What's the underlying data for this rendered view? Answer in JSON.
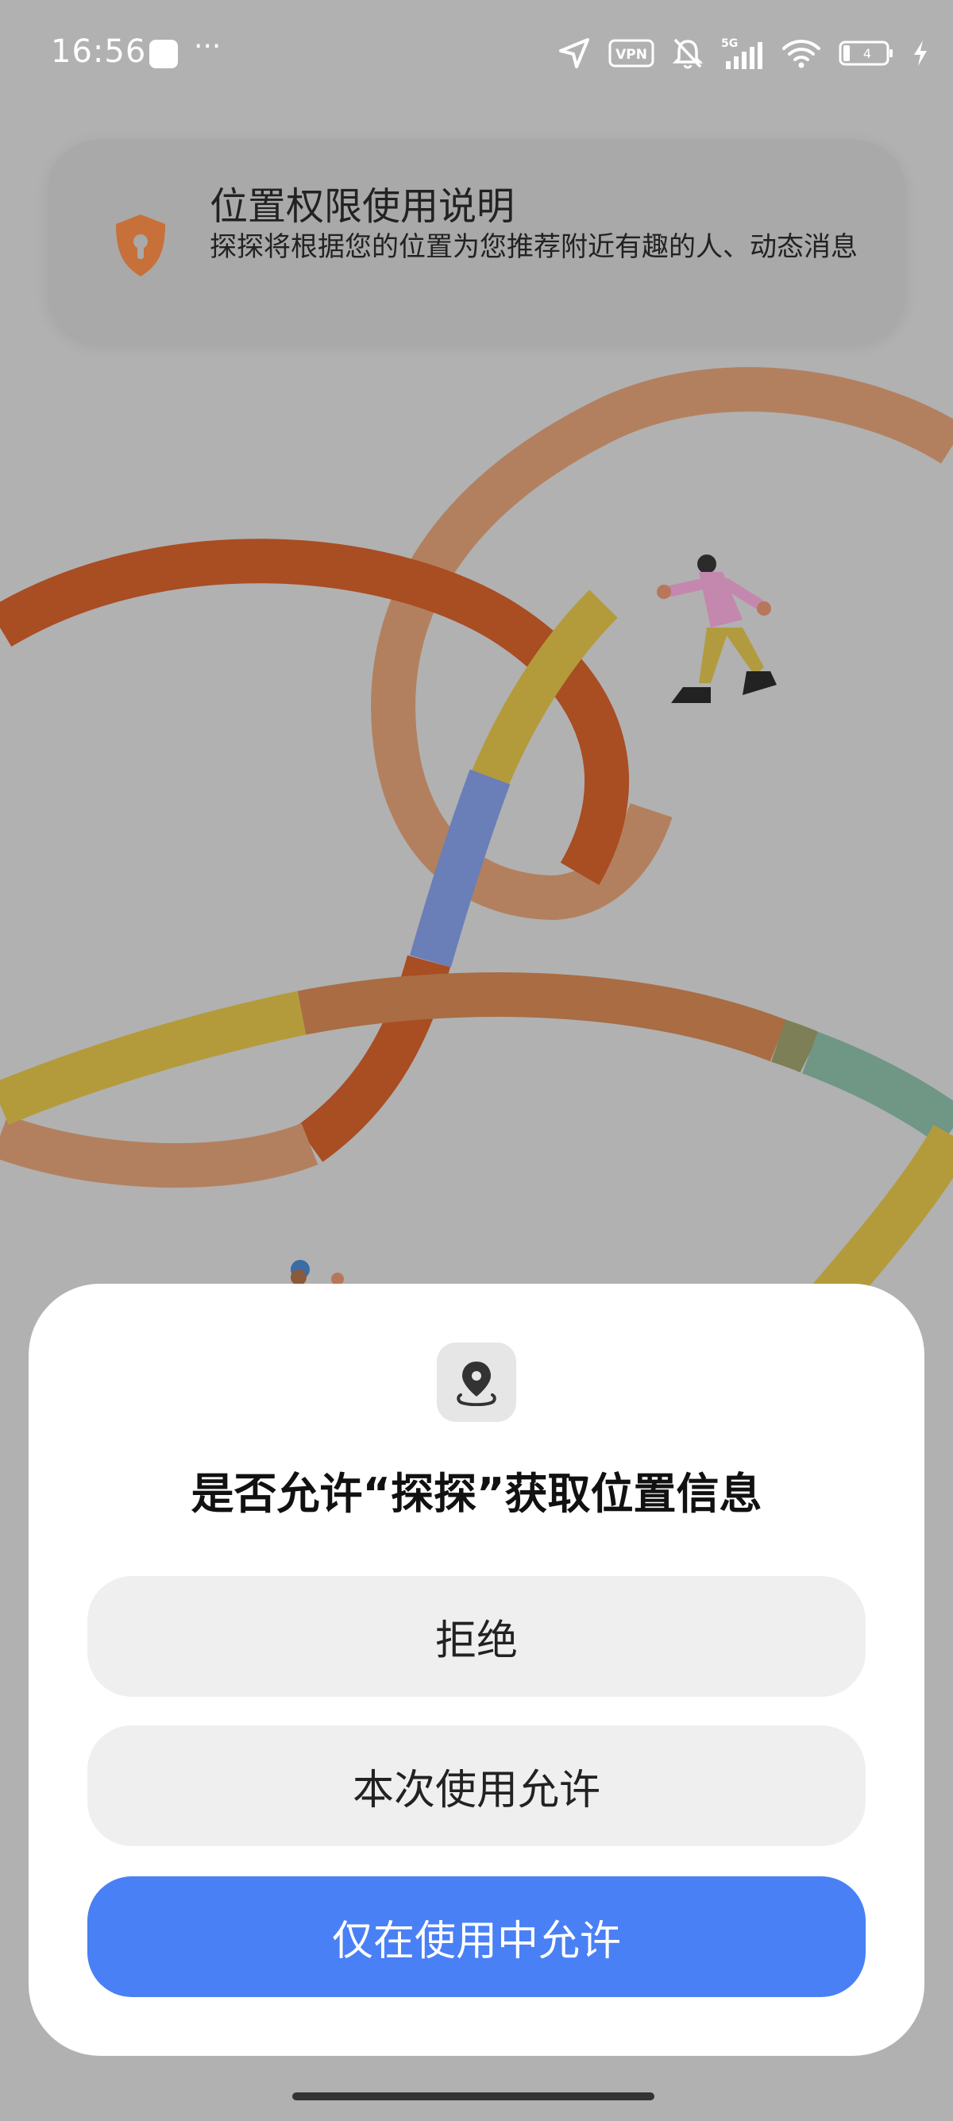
{
  "status_bar": {
    "time": "16:56",
    "more": "···",
    "vpn_label": "VPN",
    "network": "5G",
    "battery_level": "4",
    "icons": [
      "location-arrow-icon",
      "vpn-icon",
      "bell-off-icon",
      "signal-5g-icon",
      "wifi-icon",
      "battery-icon",
      "charging-icon"
    ]
  },
  "notice": {
    "icon": "shield-keyhole-icon",
    "title": "位置权限使用说明",
    "description": "探探将根据您的位置为您推荐附近有趣的人、动态消息"
  },
  "dialog": {
    "icon": "location-pin-icon",
    "title": "是否允许“探探”获取位置信息",
    "buttons": {
      "deny": "拒绝",
      "allow_once": "本次使用允许",
      "allow_while_using": "仅在使用中允许"
    }
  },
  "colors": {
    "accent": "#4a80f5",
    "notice_icon": "#c8703a",
    "dimmed_background": "#b1b1b1"
  }
}
